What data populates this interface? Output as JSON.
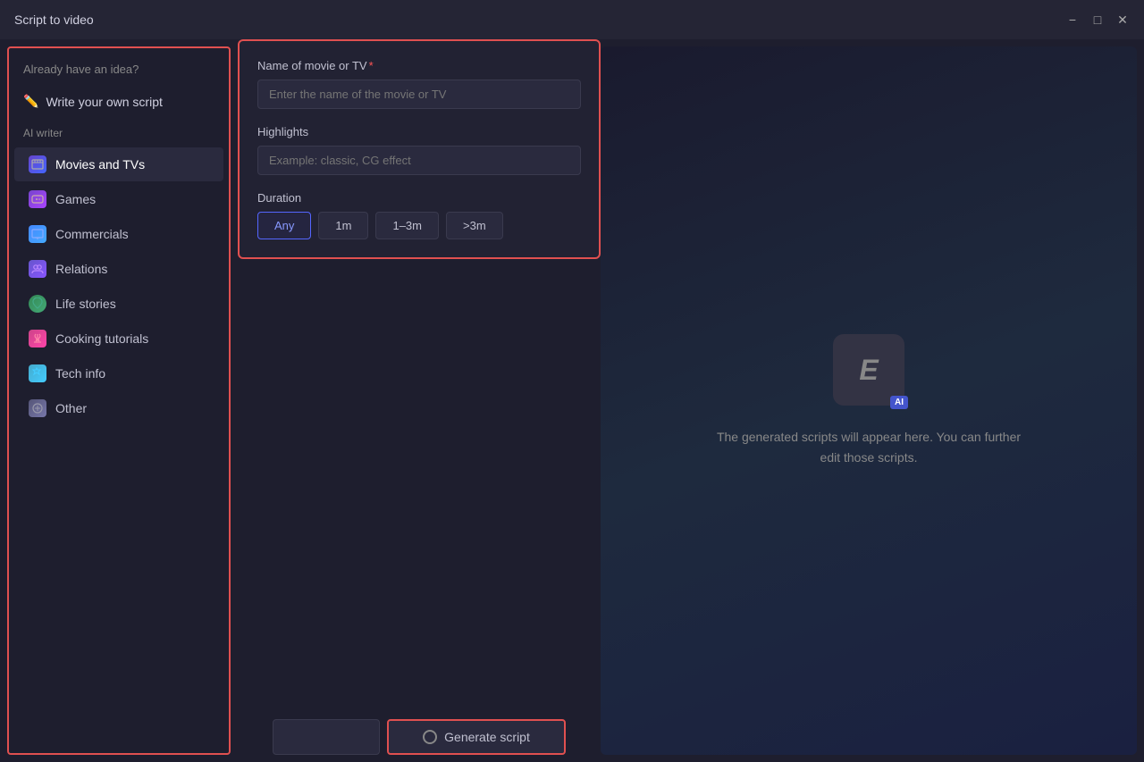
{
  "window": {
    "title": "Script to video"
  },
  "titlebar": {
    "minimize_label": "−",
    "maximize_label": "□",
    "close_label": "✕"
  },
  "sidebar": {
    "already_label": "Already have an idea?",
    "write_script_label": "Write your own script",
    "section_label": "AI writer",
    "items": [
      {
        "id": "movies",
        "label": "Movies and TVs",
        "icon": "🎬",
        "active": true
      },
      {
        "id": "games",
        "label": "Games",
        "icon": "🎮",
        "active": false
      },
      {
        "id": "commercials",
        "label": "Commercials",
        "icon": "📺",
        "active": false
      },
      {
        "id": "relations",
        "label": "Relations",
        "icon": "👥",
        "active": false
      },
      {
        "id": "life",
        "label": "Life stories",
        "icon": "🌿",
        "active": false
      },
      {
        "id": "cooking",
        "label": "Cooking tutorials",
        "icon": "🍷",
        "active": false
      },
      {
        "id": "tech",
        "label": "Tech info",
        "icon": "🔧",
        "active": false
      },
      {
        "id": "other",
        "label": "Other",
        "icon": "⚡",
        "active": false
      }
    ]
  },
  "form": {
    "name_label": "Name of movie or TV",
    "name_placeholder": "Enter the name of the movie or TV",
    "highlights_label": "Highlights",
    "highlights_placeholder": "Example: classic, CG effect",
    "duration_label": "Duration",
    "duration_buttons": [
      {
        "id": "any",
        "label": "Any",
        "active": true
      },
      {
        "id": "1m",
        "label": "1m",
        "active": false
      },
      {
        "id": "1-3m",
        "label": "1–3m",
        "active": false
      },
      {
        "id": "gt3m",
        "label": ">3m",
        "active": false
      }
    ]
  },
  "actions": {
    "back_label": "",
    "generate_label": "Generate script"
  },
  "right_panel": {
    "ai_letter": "E",
    "ai_badge": "AI",
    "description": "The generated scripts will appear here. You can further edit those scripts."
  }
}
